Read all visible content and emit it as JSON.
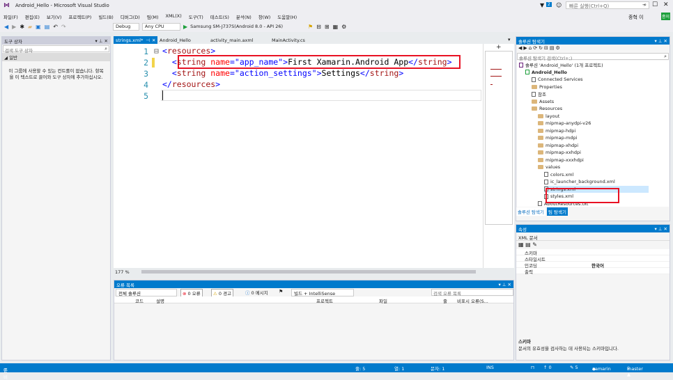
{
  "window": {
    "title": "Android_Hello - Microsoft Visual Studio",
    "quick_launch": "빠른 실행(Ctrl+Q)",
    "notif_count": "2",
    "user": "종혁 이",
    "user_badge": "종이"
  },
  "menu": [
    "파일(F)",
    "편집(E)",
    "보기(V)",
    "프로젝트(P)",
    "빌드(B)",
    "디버그(D)",
    "팀(M)",
    "XML(X)",
    "도구(T)",
    "테스트(S)",
    "분석(N)",
    "창(W)",
    "도움말(H)"
  ],
  "toolbar": {
    "config": "Debug",
    "platform": "Any CPU",
    "device": "Samsung SM-J737S(Android 8.0 - API 26)"
  },
  "toolbox": {
    "title": "도구 상자",
    "search_placeholder": "검색 도구 상자",
    "section": "◢ 일반",
    "empty_msg": "이 그룹에 사용할 수 있는 컨트롤이 없습니다. 항목을 이 텍스트로 끌어와 도구 상자에 추가하십시오."
  },
  "editor": {
    "tabs": [
      "strings.xml*",
      "Android_Hello",
      "activity_main.axml",
      "MainActivity.cs"
    ],
    "line_numbers": [
      "1",
      "2",
      "3",
      "4",
      "5"
    ],
    "lines": [
      {
        "fold": "⊟",
        "parts": [
          {
            "t": "<",
            "c": "brc"
          },
          {
            "t": "resources",
            "c": "tagc"
          },
          {
            "t": ">",
            "c": "brc"
          }
        ]
      },
      {
        "fold": "",
        "parts": [
          {
            "t": "  <",
            "c": "brc"
          },
          {
            "t": "string",
            "c": "tagc"
          },
          {
            "t": " name",
            "c": "attrc"
          },
          {
            "t": "=\"",
            "c": "brc"
          },
          {
            "t": "app_name",
            "c": "valc"
          },
          {
            "t": "\">",
            "c": "brc"
          },
          {
            "t": "First Xamarin.Android App",
            "c": "txtc"
          },
          {
            "t": "</",
            "c": "brc"
          },
          {
            "t": "string",
            "c": "tagc"
          },
          {
            "t": ">",
            "c": "brc"
          }
        ]
      },
      {
        "fold": "",
        "parts": [
          {
            "t": "  <",
            "c": "brc"
          },
          {
            "t": "string",
            "c": "tagc"
          },
          {
            "t": " name",
            "c": "attrc"
          },
          {
            "t": "=\"",
            "c": "brc"
          },
          {
            "t": "action_settings",
            "c": "valc"
          },
          {
            "t": "\">",
            "c": "brc"
          },
          {
            "t": "Settings",
            "c": "txtc"
          },
          {
            "t": "</",
            "c": "brc"
          },
          {
            "t": "string",
            "c": "tagc"
          },
          {
            "t": ">",
            "c": "brc"
          }
        ]
      },
      {
        "fold": "",
        "parts": [
          {
            "t": "</",
            "c": "brc"
          },
          {
            "t": "resources",
            "c": "tagc"
          },
          {
            "t": ">",
            "c": "brc"
          }
        ]
      },
      {
        "fold": "",
        "parts": []
      }
    ],
    "zoom": "177 %"
  },
  "errors": {
    "title": "오류 목록",
    "scope": "전체 솔루션",
    "errors": "0 오류",
    "warnings": "0 경고",
    "messages": "0 메시지",
    "build": "빌드 + IntelliSense",
    "search": "검색 오류 목록",
    "cols": [
      "코드",
      "설명",
      "프로젝트",
      "파일",
      "줄",
      "비표시 오류(S..."
    ]
  },
  "solution": {
    "title": "솔루션 탐색기",
    "search": "솔루션 탐색기 검색(Ctrl+;)",
    "items": [
      {
        "label": "솔루션 'Android_Hello' (1개 프로젝트)",
        "lvl": 0,
        "ic": "sln"
      },
      {
        "label": "Android_Hello",
        "lvl": 1,
        "ic": "proj"
      },
      {
        "label": "Connected Services",
        "lvl": 2,
        "ic": "file"
      },
      {
        "label": "Properties",
        "lvl": 2,
        "ic": "folder"
      },
      {
        "label": "참조",
        "lvl": 2,
        "ic": "file"
      },
      {
        "label": "Assets",
        "lvl": 2,
        "ic": "folder"
      },
      {
        "label": "Resources",
        "lvl": 2,
        "ic": "folder"
      },
      {
        "label": "layout",
        "lvl": 3,
        "ic": "folder"
      },
      {
        "label": "mipmap-anydpi-v26",
        "lvl": 3,
        "ic": "folder"
      },
      {
        "label": "mipmap-hdpi",
        "lvl": 3,
        "ic": "folder"
      },
      {
        "label": "mipmap-mdpi",
        "lvl": 3,
        "ic": "folder"
      },
      {
        "label": "mipmap-xhdpi",
        "lvl": 3,
        "ic": "folder"
      },
      {
        "label": "mipmap-xxhdpi",
        "lvl": 3,
        "ic": "folder"
      },
      {
        "label": "mipmap-xxxhdpi",
        "lvl": 3,
        "ic": "folder"
      },
      {
        "label": "values",
        "lvl": 3,
        "ic": "folder"
      },
      {
        "label": "colors.xml",
        "lvl": 4,
        "ic": "file"
      },
      {
        "label": "ic_launcher_background.xml",
        "lvl": 4,
        "ic": "file"
      },
      {
        "label": "strings.xml",
        "lvl": 4,
        "ic": "file"
      },
      {
        "label": "styles.xml",
        "lvl": 4,
        "ic": "file"
      },
      {
        "label": "AboutResources.txt",
        "lvl": 3,
        "ic": "file"
      }
    ],
    "tabs": [
      "솔루션 탐색기",
      "팀 탐색기"
    ]
  },
  "props": {
    "title": "속성",
    "object": "XML 문서",
    "rows": [
      [
        "스키마",
        ""
      ],
      [
        "스타일시트",
        ""
      ],
      [
        "인코딩",
        "한국어"
      ],
      [
        "출력",
        ""
      ]
    ],
    "desc_title": "스키마",
    "desc": "문서의 유효성을 검사하는 데 사용되는 스키마입니다."
  },
  "status": {
    "ready": "준비",
    "line": "줄: 5",
    "col": "열: 1",
    "char": "문자: 1",
    "ins": "INS",
    "push": "↑ 0",
    "changes": "✎ 5",
    "repo": "xamarin",
    "branch": "master ▲"
  }
}
